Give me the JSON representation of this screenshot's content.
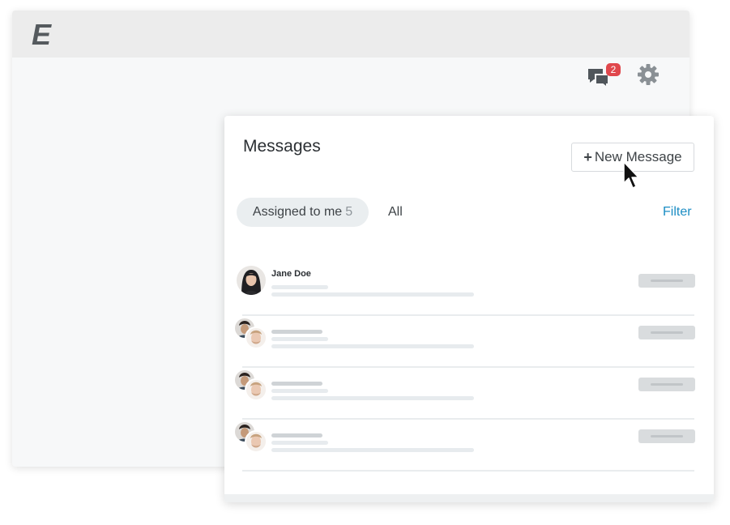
{
  "app": {
    "logo_text": "E"
  },
  "header": {
    "messages_icon": "chat-bubbles-icon",
    "messages_badge": "2",
    "settings_icon": "gear-icon"
  },
  "panel": {
    "title": "Messages",
    "new_message_label": "New Message",
    "new_message_icon": "plus-icon",
    "tabs": [
      {
        "label": "Assigned to me",
        "count": "5",
        "active": true
      },
      {
        "label": "All",
        "active": false
      }
    ],
    "filter_label": "Filter",
    "conversations": [
      {
        "name": "Jane Doe",
        "avatar": "single-woman"
      },
      {
        "name": "",
        "avatar": "group-pair"
      },
      {
        "name": "",
        "avatar": "group-pair"
      },
      {
        "name": "",
        "avatar": "group-pair"
      }
    ]
  },
  "colors": {
    "accent": "#1b8dc4",
    "badge": "#e0474c",
    "tab_active_bg": "#eaeef0"
  }
}
